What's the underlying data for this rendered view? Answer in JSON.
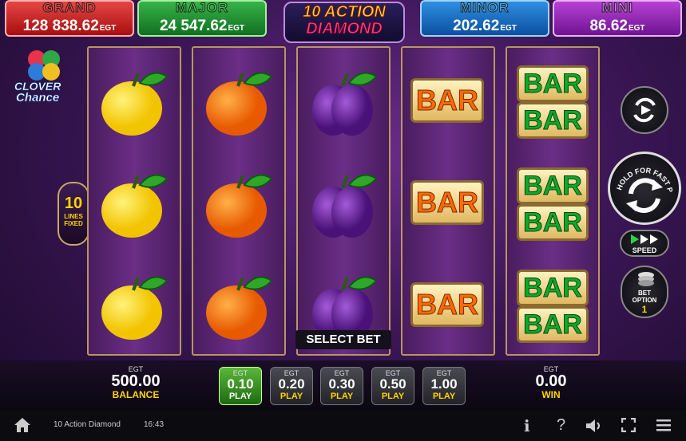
{
  "jackpots": [
    {
      "title": "GRAND",
      "value": "128 838.62",
      "unit": "EGT"
    },
    {
      "title": "MAJOR",
      "value": "24 547.62",
      "unit": "EGT"
    },
    {
      "title": "MINOR",
      "value": "202.62",
      "unit": "EGT"
    },
    {
      "title": "MINI",
      "value": "86.62",
      "unit": "EGT"
    }
  ],
  "logo": {
    "line1": "10 ACTION",
    "line2": "DIAMOND"
  },
  "clover": {
    "line1": "CLOVER",
    "line2": "Chance"
  },
  "lines": {
    "count": "10",
    "label1": "LINES",
    "label2": "FIXED"
  },
  "reels": [
    [
      "lemon",
      "lemon",
      "lemon"
    ],
    [
      "orange",
      "orange",
      "orange"
    ],
    [
      "plum",
      "plum",
      "plum"
    ],
    [
      "bar",
      "bar",
      "bar"
    ],
    [
      "double-bar",
      "double-bar",
      "double-bar"
    ]
  ],
  "bar_label": "BAR",
  "select_bet": "SELECT BET",
  "side": {
    "hold_text": "HOLD FOR FAST PLAY",
    "speed_label": "SPEED",
    "bet_option_label1": "BET",
    "bet_option_label2": "OPTION",
    "bet_option_value": "1"
  },
  "balance": {
    "unit": "EGT",
    "value": "500.00",
    "label": "BALANCE"
  },
  "win": {
    "unit": "EGT",
    "value": "0.00",
    "label": "WIN"
  },
  "bets": [
    {
      "unit": "EGT",
      "value": "0.10",
      "label": "PLAY",
      "active": true
    },
    {
      "unit": "EGT",
      "value": "0.20",
      "label": "PLAY",
      "active": false
    },
    {
      "unit": "EGT",
      "value": "0.30",
      "label": "PLAY",
      "active": false
    },
    {
      "unit": "EGT",
      "value": "0.50",
      "label": "PLAY",
      "active": false
    },
    {
      "unit": "EGT",
      "value": "1.00",
      "label": "PLAY",
      "active": false
    }
  ],
  "system": {
    "game_name": "10 Action Diamond",
    "time": "16:43",
    "icons": [
      "home-icon",
      "info-icon",
      "help-icon",
      "sound-icon",
      "fullscreen-icon",
      "menu-icon"
    ]
  },
  "colors": {
    "grand": "#c81f1f",
    "major": "#1e8f2e",
    "minor": "#1c6fc8",
    "mini": "#8f25b0",
    "active_bet": "#3c9a25",
    "label_yellow": "#ffd400"
  }
}
